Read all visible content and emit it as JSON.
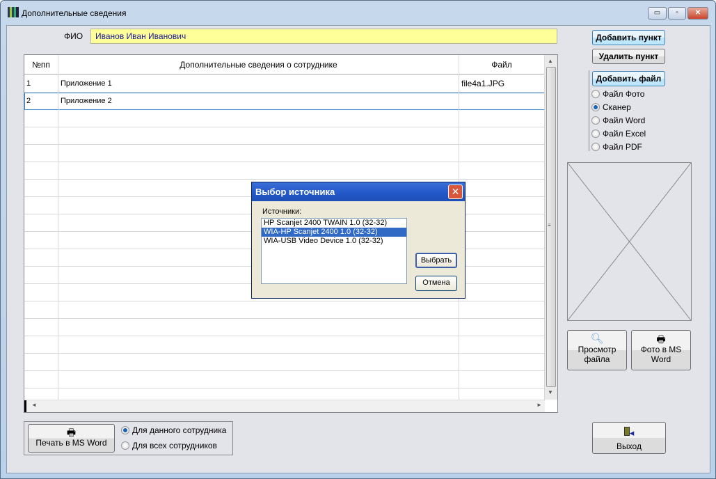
{
  "window": {
    "title": "Дополнительные сведения",
    "minimize": "▭",
    "maximize": "▫",
    "close": "✕"
  },
  "fio": {
    "label": "ФИО",
    "value": "Иванов Иван Иванович"
  },
  "table": {
    "columns": [
      "№пп",
      "Дополнительные сведения о сотруднике",
      "Файл"
    ],
    "rows": [
      {
        "num": "1",
        "info": "Приложение 1",
        "file": "file4a1.JPG"
      },
      {
        "num": "2",
        "info": "Приложение 2",
        "file": ""
      }
    ]
  },
  "buttons": {
    "add_item": "Добавить пункт",
    "delete_item": "Удалить пункт",
    "add_file": "Добавить файл",
    "view_file": "Просмотр файла",
    "photo_word": "Фото в MS Word",
    "print_word": "Печать в MS Word",
    "exit": "Выход"
  },
  "file_type": {
    "options": [
      "Файл Фото",
      "Сканер",
      "Файл Word",
      "Файл Excel",
      "Файл PDF"
    ],
    "selected": "Сканер"
  },
  "print_scope": {
    "options": [
      "Для данного сотрудника",
      "Для всех сотрудников"
    ],
    "selected": "Для данного сотрудника"
  },
  "dialog": {
    "title": "Выбор источника",
    "sources_label": "Источники:",
    "sources": [
      "HP Scanjet 2400 TWAIN 1.0 (32-32)",
      "WIA-HP Scanjet 2400 1.0 (32-32)",
      "WIA-USB Video Device 1.0 (32-32)"
    ],
    "selected": "WIA-HP Scanjet 2400 1.0 (32-32)",
    "select": "Выбрать",
    "cancel": "Отмена",
    "close": "✕"
  }
}
